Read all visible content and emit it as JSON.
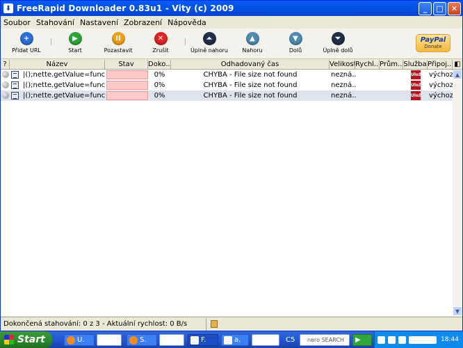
{
  "window": {
    "title": "FreeRapid Downloader 0.83u1 - Vity (c) 2009",
    "icon_glyph": "⬇"
  },
  "menu": [
    "Soubor",
    "Stahování",
    "Nastavení",
    "Zobrazení",
    "Nápověda"
  ],
  "toolbar": {
    "add_url": "Přidat URL",
    "start": "Start",
    "pause": "Pozastavit",
    "cancel": "Zrušit",
    "top": "Úplně nahoru",
    "up": "Nahoru",
    "down": "Dolů",
    "bottom": "Úplně dolů",
    "paypal": "PayPal",
    "donate": "Donate"
  },
  "columns": [
    "?",
    "Název",
    "Stav",
    "Doko...",
    "Odhadovaný čas",
    "Velikost",
    "Rychl...",
    "Prům...",
    "Služba",
    "Připoj..."
  ],
  "rows": [
    {
      "name": "|();nette.getValue=functi...",
      "progress": "0%",
      "eta": "CHYBA - File size not found",
      "size": "nezná...",
      "service": "Ulož",
      "connection": "výchozí"
    },
    {
      "name": "|();nette.getValue=functi...",
      "progress": "0%",
      "eta": "CHYBA - File size not found",
      "size": "nezná...",
      "service": "Ulož",
      "connection": "výchozí"
    },
    {
      "name": "|();nette.getValue=functi...",
      "progress": "0%",
      "eta": "CHYBA - File size not found",
      "size": "nezná...",
      "service": "Ulož",
      "connection": "výchozí"
    }
  ],
  "status": {
    "text": "Dokončená stahování: 0 z 3 - Aktuální rychlost: 0 B/s"
  },
  "taskbar": {
    "start": "Start",
    "tasks": [
      "U.",
      "S.",
      "F.",
      "a.",
      "C5"
    ],
    "nero": "nero SEARCH",
    "clock": "18:44"
  },
  "colors": {
    "title": "#0453e3",
    "stav_fill": "#fdc9c9",
    "selected_row": "#dde4ee",
    "taskbar": "#2157d7",
    "start": "#2c8a2c"
  }
}
